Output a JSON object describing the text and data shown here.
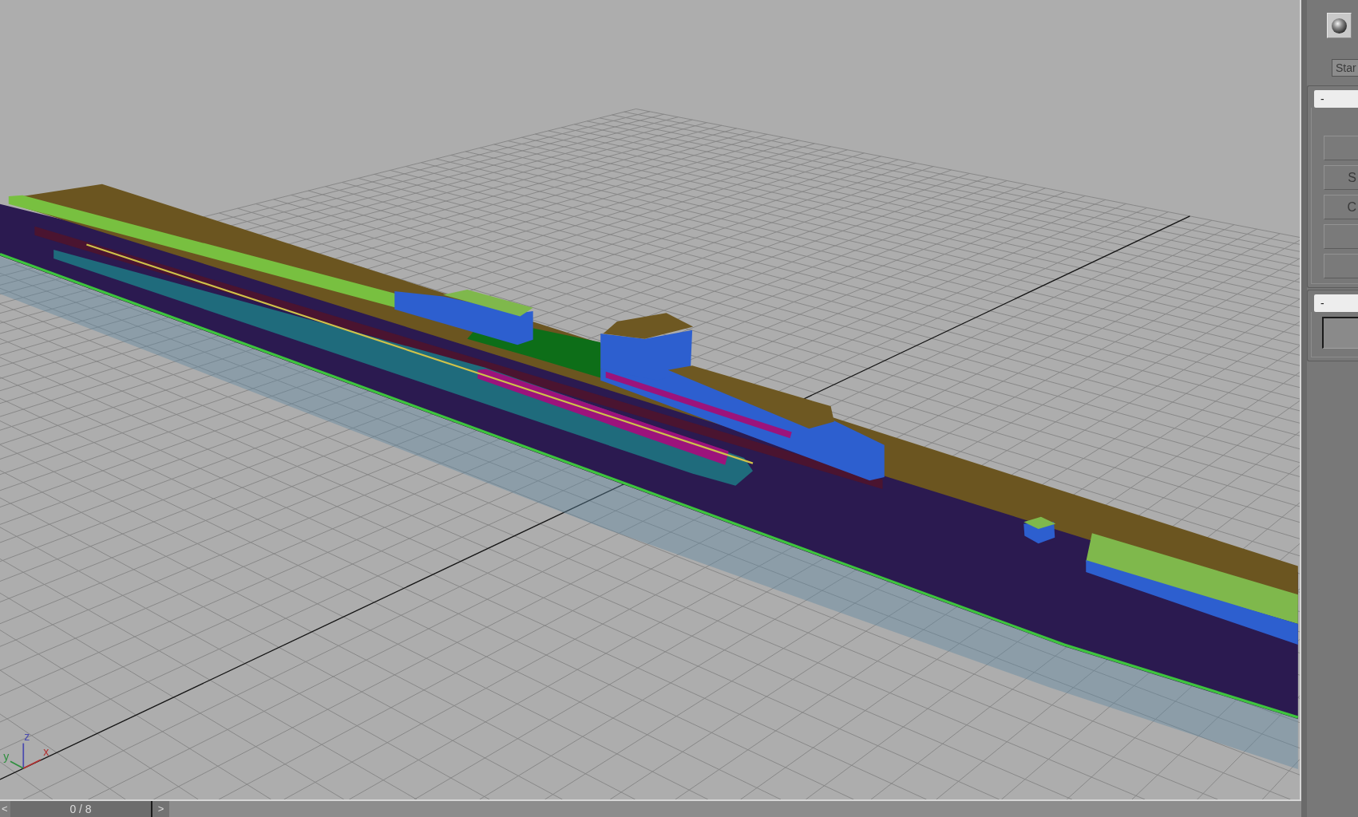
{
  "viewport": {
    "axis_gizmo": [
      {
        "label": "z",
        "color": "#4a4aae"
      },
      {
        "label": "y",
        "color": "#2f8f3f"
      },
      {
        "label": "x",
        "color": "#b23232"
      }
    ]
  },
  "time_slider": {
    "prev": "<",
    "frame": "0 / 8",
    "next": ">"
  },
  "command_panel": {
    "type_button": "Star",
    "rollouts": [
      {
        "header": "-",
        "items": [
          {
            "kind": "button"
          },
          {
            "kind": "button",
            "label": "S"
          },
          {
            "kind": "button",
            "label": "C"
          },
          {
            "kind": "button"
          },
          {
            "kind": "button"
          }
        ]
      },
      {
        "header": "-",
        "items": [
          {
            "kind": "field"
          }
        ]
      }
    ]
  }
}
